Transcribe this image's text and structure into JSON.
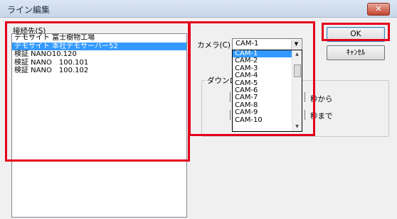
{
  "window": {
    "title": "ライン編集",
    "close_label": "✕"
  },
  "connection": {
    "label": "接続先(S)",
    "items": [
      "デモサイト 富士樹物工場",
      "デモサイト 本社デモサーバー52",
      "検証 NANO10.120",
      "検証 NANO　100.101",
      "検証 NANO　100.102"
    ],
    "selected_index": 1
  },
  "camera": {
    "label": "カメラ(C)",
    "value": "CAM-1",
    "options": [
      "CAM-1",
      "CAM-2",
      "CAM-3",
      "CAM-4",
      "CAM-5",
      "CAM-6",
      "CAM-7",
      "CAM-8",
      "CAM-9",
      "CAM-10"
    ],
    "selected_index": 0
  },
  "download": {
    "group_label": "ダウンロ",
    "from_label": "秒から",
    "to_label": "秒まで"
  },
  "buttons": {
    "ok": "OK",
    "cancel": "ｷｬﾝｾﾙ"
  },
  "icons": {
    "combo_arrow": "▼",
    "scroll_up": "▲",
    "scroll_down": "▼"
  }
}
